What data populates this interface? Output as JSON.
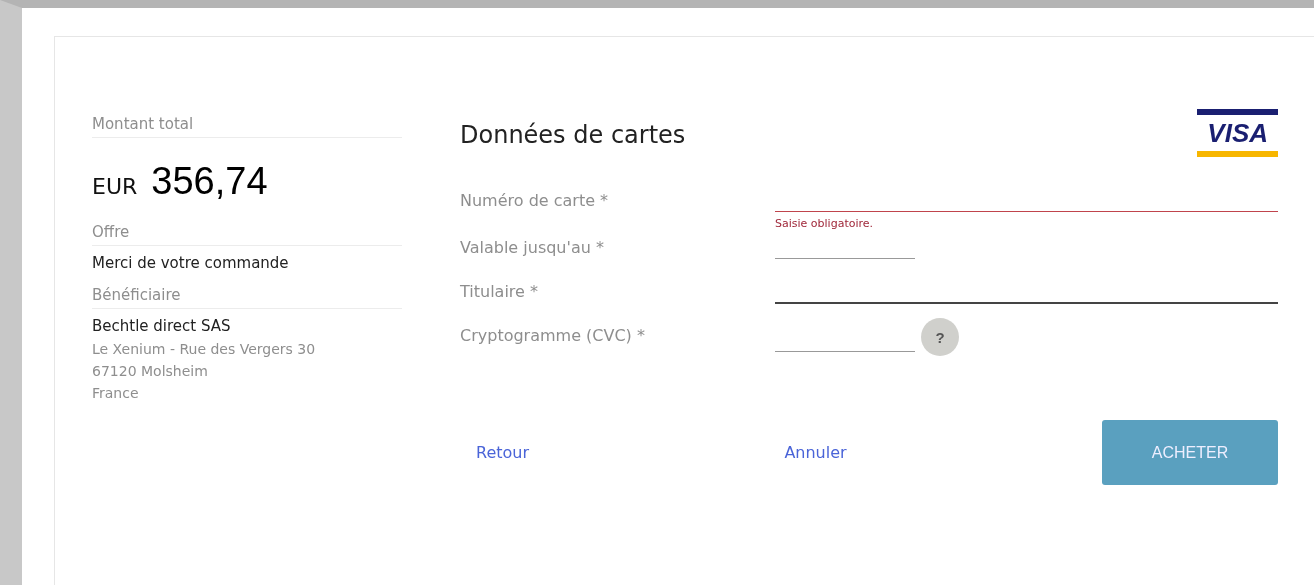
{
  "summary": {
    "total_label": "Montant total",
    "currency": "EUR",
    "amount": "356,74",
    "offer_label": "Offre",
    "offer": "Merci de votre commande",
    "beneficiary_label": "Bénéficiaire",
    "beneficiary_name": "Bechtle direct SAS",
    "address_lines": [
      "Le Xenium - Rue des Vergers 30",
      "67120 Molsheim",
      "France"
    ]
  },
  "form": {
    "title": "Données de cartes",
    "card_brand": "VISA",
    "fields": [
      {
        "label": "Numéro de carte *",
        "kind": "wide",
        "focused": false,
        "error": "Saisie obligatoire."
      },
      {
        "label": "Valable jusqu'au *",
        "kind": "short",
        "focused": false
      },
      {
        "label": "Titulaire *",
        "kind": "wide",
        "focused": true
      },
      {
        "label": "Cryptogramme (CVC) *",
        "kind": "short",
        "focused": false,
        "help": "?"
      }
    ]
  },
  "actions": {
    "back": "Retour",
    "cancel": "Annuler",
    "buy": "ACHETER"
  }
}
